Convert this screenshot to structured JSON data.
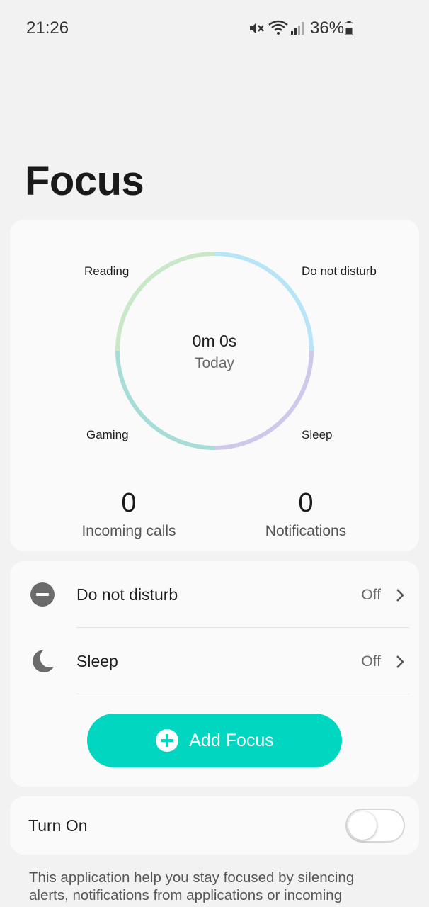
{
  "status_bar": {
    "time": "21:26",
    "battery_percent": "36%",
    "icons": [
      "mute-icon",
      "wifi-icon",
      "signal-icon",
      "battery-icon"
    ]
  },
  "page": {
    "title": "Focus"
  },
  "summary": {
    "ring_labels": {
      "reading": "Reading",
      "do_not_disturb": "Do not disturb",
      "gaming": "Gaming",
      "sleep": "Sleep"
    },
    "ring_colors": {
      "reading": "#c8e8c8",
      "do_not_disturb": "#b8e4f8",
      "gaming": "#a8dcd8",
      "sleep": "#d0c8ec"
    },
    "total_time": "0m 0s",
    "period": "Today",
    "stats": [
      {
        "value": "0",
        "label": "Incoming calls"
      },
      {
        "value": "0",
        "label": "Notifications"
      }
    ]
  },
  "modes": [
    {
      "title": "Do not disturb",
      "status": "Off",
      "icon": "do-not-disturb-icon"
    },
    {
      "title": "Sleep",
      "status": "Off",
      "icon": "moon-icon"
    }
  ],
  "add_focus": {
    "label": "Add Focus",
    "color": "#00d6c0"
  },
  "turn_on": {
    "label": "Turn On",
    "enabled": false
  },
  "description": "This application help you stay focused by silencing alerts, notifications from applications or incoming"
}
